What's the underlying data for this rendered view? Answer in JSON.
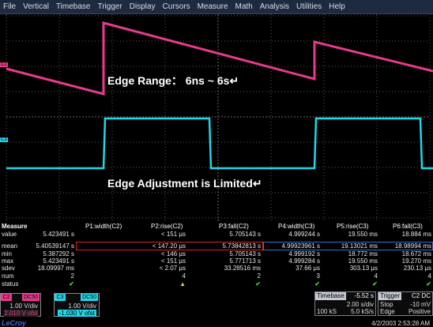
{
  "menu": [
    "File",
    "Vertical",
    "Timebase",
    "Trigger",
    "Display",
    "Cursors",
    "Measure",
    "Math",
    "Analysis",
    "Utilities",
    "Help"
  ],
  "channels": {
    "c2": {
      "tag": "C2",
      "coupling": "DC50",
      "vdiv": "1.00 V/div",
      "offset": "2.010 V ofst",
      "color": "#e83a8c"
    },
    "c3": {
      "tag": "C3",
      "coupling": "DC50",
      "vdiv": "1.00 V/div",
      "offset": "-1.030 V ofst",
      "color": "#22d6e8"
    }
  },
  "annotations": {
    "edge_range": "Edge Range：  6ns ~ 6s↵",
    "edge_adjust": "Edge Adjustment is Limited↵"
  },
  "measure": {
    "header_label": "Measure",
    "columns": [
      "P1:width(C2)",
      "P2:rise(C2)",
      "P3:fall(C2)",
      "P4:width(C3)",
      "P5:rise(C3)",
      "P6:fall(C3)"
    ],
    "rows": [
      {
        "label": "value",
        "cells": [
          "5.423491 s",
          "< 151 µs",
          "5.705143 s",
          "4.999244 s",
          "19.550 ms",
          "18.884 ms"
        ]
      },
      {
        "label": "mean",
        "cells": [
          "5.40539147 s",
          "< 147.20 µs",
          "5.73842813 s",
          "4.99923961 s",
          "19.13021 ms",
          "18.98994 ms"
        ]
      },
      {
        "label": "min",
        "cells": [
          "5.387292 s",
          "< 146 µs",
          "5.705143 s",
          "4.999192 s",
          "18.772 ms",
          "18.672 ms"
        ]
      },
      {
        "label": "max",
        "cells": [
          "5.423491 s",
          "< 151 µs",
          "5.771713 s",
          "4.999284 s",
          "19.550 ms",
          "19.270 ms"
        ]
      },
      {
        "label": "sdev",
        "cells": [
          "18.09997 ms",
          "< 2.07 µs",
          "33.28516 ms",
          "37.66 µs",
          "303.13 µs",
          "230.13 µs"
        ]
      },
      {
        "label": "num",
        "cells": [
          "2",
          "4",
          "2",
          "3",
          "4",
          "4"
        ]
      },
      {
        "label": "status",
        "cells": [
          "✔",
          "▲",
          "✔",
          "✔",
          "✔",
          "✔"
        ]
      }
    ]
  },
  "timebase": {
    "label": "Timebase",
    "delay": "-5.52 s",
    "sdiv": "2.00 s/div",
    "samples": "100 kS",
    "rate": "5.0 kS/s"
  },
  "trigger": {
    "label": "Trigger",
    "source_coupling": "C2 DC",
    "mode": "Stop",
    "level": "-10 mV",
    "type": "Edge",
    "slope": "Positive"
  },
  "brand": "LeCroy",
  "datetime": "4/2/2003 2:53:28 AM"
}
